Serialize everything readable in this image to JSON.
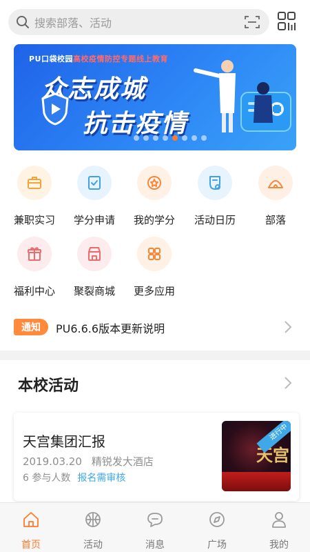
{
  "search": {
    "placeholder": "搜索部落、活动"
  },
  "banner": {
    "ribbon_prefix": "PU口袋校园",
    "ribbon_highlight": "高校疫情防控专题线上教育",
    "line1": "众志成城",
    "line2": "抗击疫情",
    "dot_count": 8,
    "active_dot": 4
  },
  "apps": [
    {
      "label": "兼职实习",
      "icon": "briefcase-icon",
      "bg": "#fff4e3",
      "color": "#f0a53b"
    },
    {
      "label": "学分申请",
      "icon": "checklist-icon",
      "bg": "#e8f4fd",
      "color": "#3fa0e4"
    },
    {
      "label": "我的学分",
      "icon": "star-badge-icon",
      "bg": "#fff1e6",
      "color": "#f28a3a"
    },
    {
      "label": "活动日历",
      "icon": "calendar-icon",
      "bg": "#e8f4fd",
      "color": "#3fa0e4"
    },
    {
      "label": "部落",
      "icon": "tent-icon",
      "bg": "#fff0e6",
      "color": "#f28a3a"
    },
    {
      "label": "福利中心",
      "icon": "gift-icon",
      "bg": "#fdeced",
      "color": "#ec6b6b"
    },
    {
      "label": "聚裂商城",
      "icon": "shop-icon",
      "bg": "#fdeced",
      "color": "#ec6b6b"
    },
    {
      "label": "更多应用",
      "icon": "grid-icon",
      "bg": "#fff1e6",
      "color": "#f28a3a"
    }
  ],
  "notice": {
    "tag": "通知",
    "text": "PU6.6.6版本更新说明"
  },
  "section": {
    "title": "本校活动"
  },
  "activity": {
    "title": "天宫集团汇报",
    "date": "2019.03.20",
    "venue": "精锐发大酒店",
    "participants": "6 参与人数",
    "status_link": "报名需审核",
    "badge": "进行中",
    "thumb_text": "天宫"
  },
  "tabs": [
    {
      "label": "首页",
      "icon": "home-icon",
      "active": true
    },
    {
      "label": "活动",
      "icon": "basketball-icon",
      "active": false
    },
    {
      "label": "消息",
      "icon": "chat-icon",
      "active": false
    },
    {
      "label": "广场",
      "icon": "compass-icon",
      "active": false
    },
    {
      "label": "我的",
      "icon": "person-icon",
      "active": false
    }
  ],
  "colors": {
    "accent": "#ff7a2e",
    "link": "#3ea8e8",
    "banner_blue": "#1f63e8"
  }
}
